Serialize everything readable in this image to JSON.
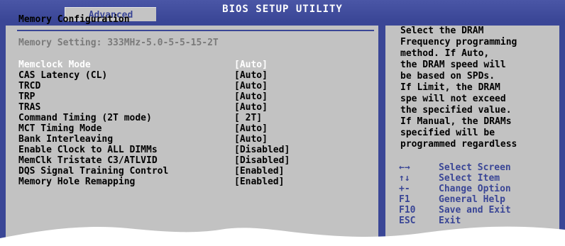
{
  "header": {
    "title": "BIOS SETUP UTILITY",
    "active_tab": "Advanced"
  },
  "main": {
    "section_title": "Memory Configuration",
    "memory_setting": "Memory Setting: 333MHz-5.0-5-5-15-2T",
    "items": [
      {
        "label": "Memclock Mode",
        "value": "[Auto]",
        "selected": true
      },
      {
        "label": "CAS Latency (CL)",
        "value": "[Auto]"
      },
      {
        "label": "TRCD",
        "value": "[Auto]"
      },
      {
        "label": "TRP",
        "value": "[Auto]"
      },
      {
        "label": "TRAS",
        "value": "[Auto]"
      },
      {
        "label": "Command Timing (2T mode)",
        "value": "[ 2T]"
      },
      {
        "label": "MCT Timing Mode",
        "value": "[Auto]"
      },
      {
        "label": "Bank Interleaving",
        "value": "[Auto]"
      },
      {
        "label": "Enable Clock to ALL DIMMs",
        "value": "[Disabled]"
      },
      {
        "label": "MemClk Tristate C3/ATLVID",
        "value": "[Disabled]"
      },
      {
        "label": "DQS Signal Training Control",
        "value": "[Enabled]"
      },
      {
        "label": "Memory Hole Remapping",
        "value": "[Enabled]"
      }
    ]
  },
  "help": {
    "lines": [
      "Select the DRAM",
      "Frequency programming",
      "method. If Auto,",
      "the DRAM speed will",
      "be based on SPDs.",
      "If Limit, the DRAM",
      "spe will not exceed",
      "the specified value.",
      "If Manual, the DRAMs",
      "specified will be",
      "programmed regardless"
    ],
    "keys": [
      {
        "key": "←→",
        "action": "Select Screen"
      },
      {
        "key": "↑↓",
        "action": "Select Item"
      },
      {
        "key": "+-",
        "action": "Change Option"
      },
      {
        "key": "F1",
        "action": "General Help"
      },
      {
        "key": "F10",
        "action": "Save and Exit"
      },
      {
        "key": "ESC",
        "action": "Exit"
      }
    ]
  },
  "colors": {
    "frame": "#3a4696",
    "panel": "#c2c2c2",
    "key_text": "#3a4696",
    "selected_text": "#ffffff"
  }
}
